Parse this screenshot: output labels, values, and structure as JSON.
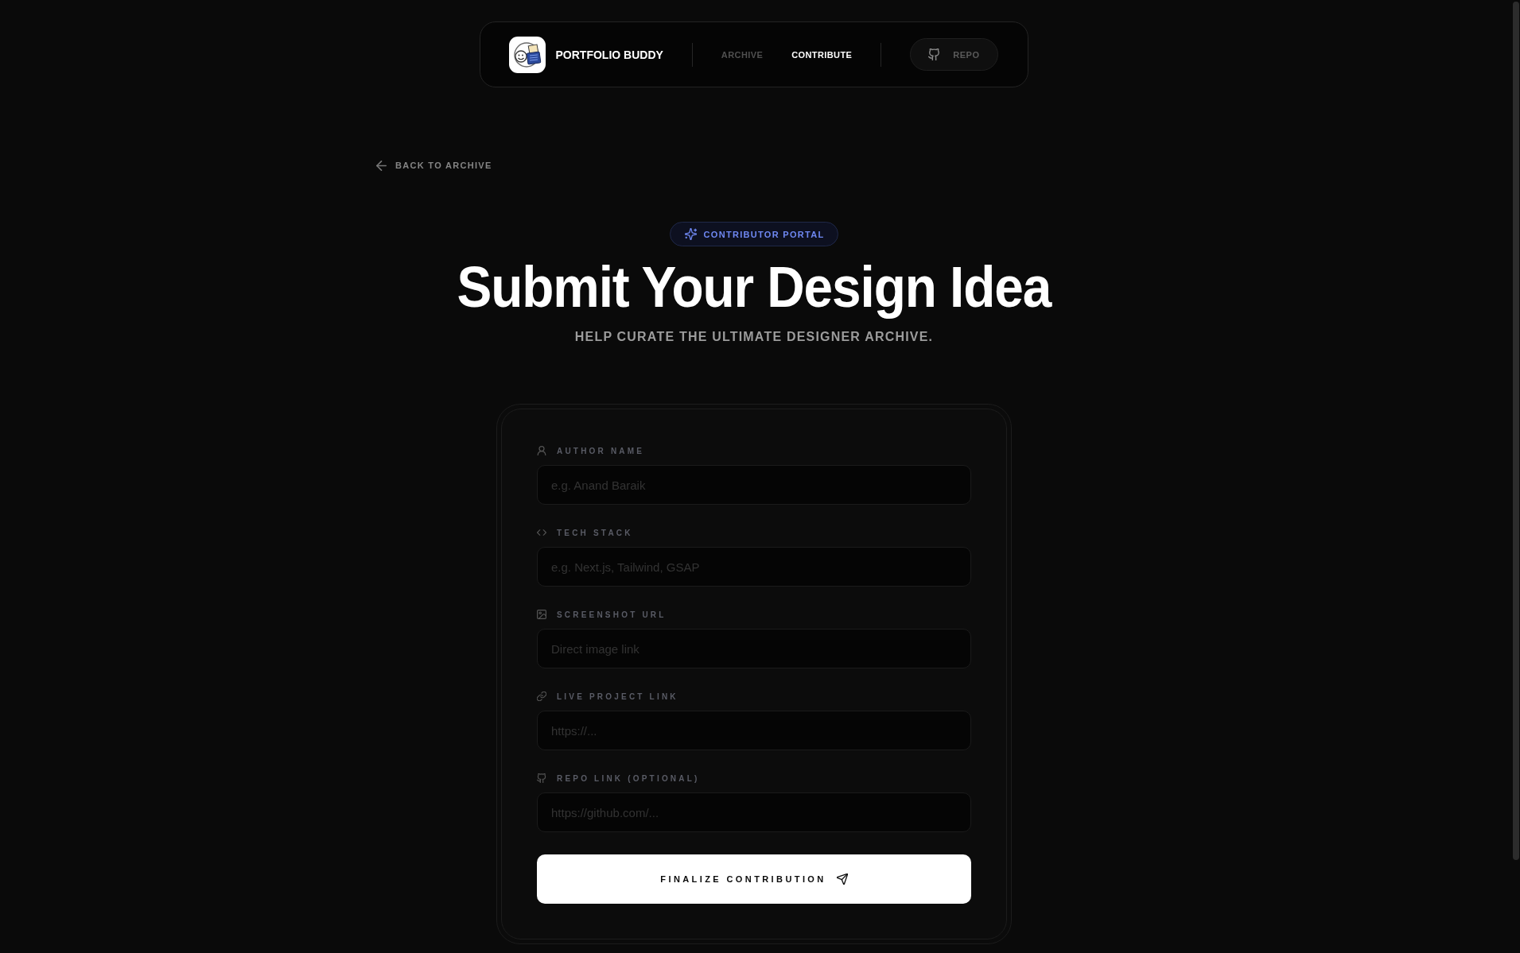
{
  "nav": {
    "brand": "PORTFOLIO BUDDY",
    "links": [
      {
        "label": "ARCHIVE",
        "selected": false
      },
      {
        "label": "CONTRIBUTE",
        "selected": true
      }
    ],
    "repo_button": "REPO"
  },
  "back_link": "BACK TO ARCHIVE",
  "badge": "CONTRIBUTOR PORTAL",
  "title": "Submit Your Design Idea",
  "subtitle": "HELP CURATE THE ULTIMATE DESIGNER ARCHIVE.",
  "form": {
    "fields": [
      {
        "label": "AUTHOR NAME",
        "placeholder": "e.g. Anand Baraik"
      },
      {
        "label": "TECH STACK",
        "placeholder": "e.g. Next.js, Tailwind, GSAP"
      },
      {
        "label": "SCREENSHOT URL",
        "placeholder": "Direct image link"
      },
      {
        "label": "LIVE PROJECT LINK",
        "placeholder": "https://..."
      },
      {
        "label": "REPO LINK (OPTIONAL)",
        "placeholder": "https://github.com/..."
      }
    ],
    "submit_button": "FINALIZE CONTRIBUTION"
  }
}
